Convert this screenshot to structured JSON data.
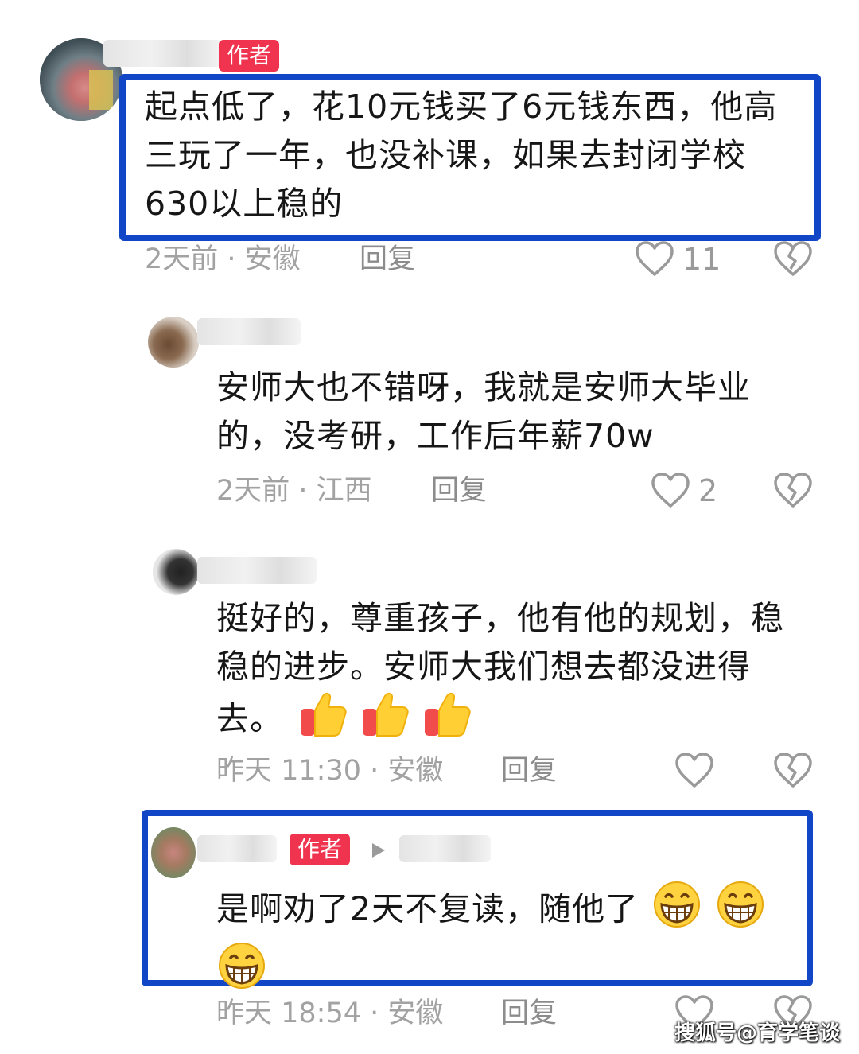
{
  "badges": {
    "author": "作者"
  },
  "comments": [
    {
      "text": "起点低了，花10元钱买了6元钱东西，他高三玩了一年，也没补课，如果去封闭学校630以上稳的",
      "meta": "2天前 · 安徽",
      "reply_label": "回复",
      "likes": "11",
      "is_author": true
    },
    {
      "text": "安师大也不错呀，我就是安师大毕业的，没考研，工作后年薪70w",
      "meta": "2天前 · 江西",
      "reply_label": "回复",
      "likes": "2"
    },
    {
      "text": "挺好的，尊重孩子，他有他的规划，稳稳的进步。安师大我们想去都没进得去。",
      "emoji": [
        "thumbs-up",
        "thumbs-up",
        "thumbs-up"
      ],
      "meta": "昨天 11:30 · 安徽",
      "reply_label": "回复",
      "likes": ""
    },
    {
      "text": "是啊劝了2天不复读，随他了",
      "emoji": [
        "grinning-face",
        "grinning-face",
        "grinning-face"
      ],
      "meta": "昨天 18:54 · 安徽",
      "reply_label": "回复",
      "likes": "",
      "is_author": true
    }
  ],
  "watermark": "搜狐号@育学笔谈",
  "colors": {
    "highlight_border": "#1147c7",
    "author_badge": "#f0334f",
    "meta_text": "#a2a2a2"
  }
}
